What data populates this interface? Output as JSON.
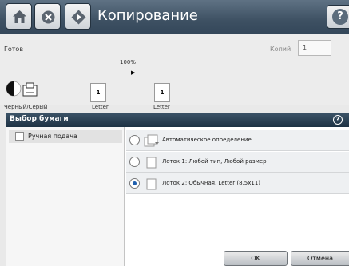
{
  "titlebar": {
    "title": "Копирование",
    "home_icon": "home-icon",
    "stop_icon": "stop-icon",
    "start_icon": "start-icon",
    "help_icon": "help-icon",
    "help_glyph": "?"
  },
  "status": {
    "state": "Готов",
    "copies_label": "Копий",
    "copies_value": "1",
    "zoom": "100%",
    "source_page_number": "1",
    "dest_page_number": "1",
    "source_paper": "Letter",
    "dest_paper": "Letter",
    "color_mode": "Черный/Серый"
  },
  "dialog": {
    "title": "Выбор бумаги",
    "help_glyph": "?",
    "manual_feed_label": "Ручная подача",
    "options": [
      {
        "label": "Автоматическое определение",
        "selected": false,
        "icon": "auto-detect-icon"
      },
      {
        "label": "Лоток 1: Любой тип, Любой размер",
        "selected": false,
        "icon": "paper-icon"
      },
      {
        "label": "Лоток 2: Обычная, Letter (8.5x11)",
        "selected": true,
        "icon": "paper-icon"
      }
    ],
    "ok_label": "OK",
    "cancel_label": "Отмена"
  },
  "colors": {
    "titlebar": "#3e5163",
    "dialog_header": "#1d3244",
    "radio_selected": "#1f5fae"
  }
}
